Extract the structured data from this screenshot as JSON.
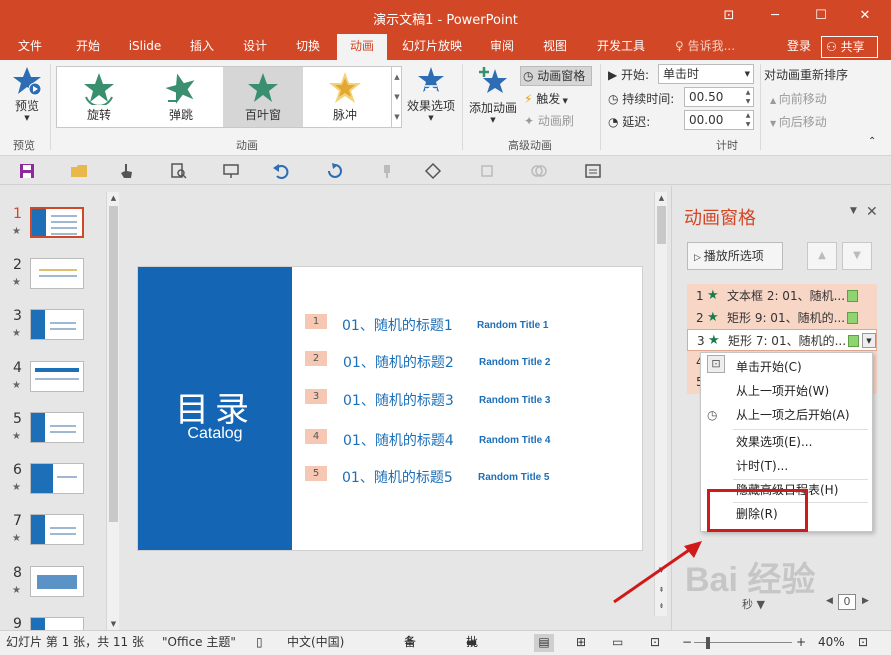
{
  "window": {
    "title": "演示文稿1 - PowerPoint"
  },
  "tabs": [
    {
      "label": "文件"
    },
    {
      "label": "开始"
    },
    {
      "label": "iSlide"
    },
    {
      "label": "插入"
    },
    {
      "label": "设计"
    },
    {
      "label": "切换"
    },
    {
      "label": "动画"
    },
    {
      "label": "幻灯片放映"
    },
    {
      "label": "审阅"
    },
    {
      "label": "视图"
    },
    {
      "label": "开发工具"
    }
  ],
  "tellme": "告诉我...",
  "login": "登录",
  "share": "共享",
  "ribbon": {
    "preview": {
      "label": "预览",
      "group": "预览"
    },
    "animation_gallery": {
      "items": [
        {
          "label": "旋转",
          "color": "#3a8f6e"
        },
        {
          "label": "弹跳",
          "color": "#3a8f6e"
        },
        {
          "label": "百叶窗",
          "color": "#3a8f6e"
        },
        {
          "label": "脉冲",
          "color": "#e2b84a"
        }
      ],
      "group": "动画"
    },
    "effect_options": "效果选项",
    "add_animation": "添加动画",
    "animation_pane": "动画窗格",
    "trigger": "触发",
    "animation_painter": "动画刷",
    "advanced_group": "高级动画",
    "timing": {
      "start_label": "开始:",
      "start_value": "单击时",
      "duration_label": "持续时间:",
      "duration_value": "00.50",
      "delay_label": "延迟:",
      "delay_value": "00.00",
      "group": "计时"
    },
    "reorder": {
      "title": "对动画重新排序",
      "earlier": "向前移动",
      "later": "向后移动"
    }
  },
  "thumbnails": [
    {
      "num": "1",
      "star": "★"
    },
    {
      "num": "2",
      "star": "★"
    },
    {
      "num": "3",
      "star": "★"
    },
    {
      "num": "4",
      "star": "★"
    },
    {
      "num": "5",
      "star": "★"
    },
    {
      "num": "6",
      "star": "★"
    },
    {
      "num": "7",
      "star": "★"
    },
    {
      "num": "8",
      "star": "★"
    },
    {
      "num": "9",
      "star": ""
    }
  ],
  "slide": {
    "title": "目录",
    "subtitle": "Catalog",
    "items": [
      {
        "num": "1",
        "cn": "01、随机的标题1",
        "en": "Random Title 1"
      },
      {
        "num": "2",
        "cn": "01、随机的标题2",
        "en": "Random Title 2"
      },
      {
        "num": "3",
        "cn": "01、随机的标题3",
        "en": "Random Title 3"
      },
      {
        "num": "4",
        "cn": "01、随机的标题4",
        "en": "Random Title 4"
      },
      {
        "num": "5",
        "cn": "01、随机的标题5",
        "en": "Random Title 5"
      }
    ]
  },
  "pane": {
    "title": "动画窗格",
    "play_button": "播放所选项",
    "animations": [
      {
        "index": "1",
        "text": "文本框 2: 01、随机..."
      },
      {
        "index": "2",
        "text": "矩形 9: 01、随机的..."
      },
      {
        "index": "3",
        "text": "矩形 7: 01、随机的..."
      },
      {
        "index": "4",
        "text": ""
      },
      {
        "index": "5",
        "text": ""
      }
    ],
    "context_menu": [
      {
        "label": "单击开始(C)"
      },
      {
        "label": "从上一项开始(W)"
      },
      {
        "label": "从上一项之后开始(A)"
      },
      {
        "label": "效果选项(E)..."
      },
      {
        "label": "计时(T)..."
      },
      {
        "label": "隐藏高级日程表(H)"
      },
      {
        "label": "删除(R)"
      }
    ],
    "seconds_label": "秒",
    "seconds_value": "0"
  },
  "status": {
    "slide_info": "幻灯片 第 1 张，共 11 张",
    "theme": "\"Office 主题\"",
    "language": "中文(中国)",
    "notes": "备注",
    "comments": "批注",
    "zoom": "40%"
  },
  "watermark": "Bai 经验"
}
